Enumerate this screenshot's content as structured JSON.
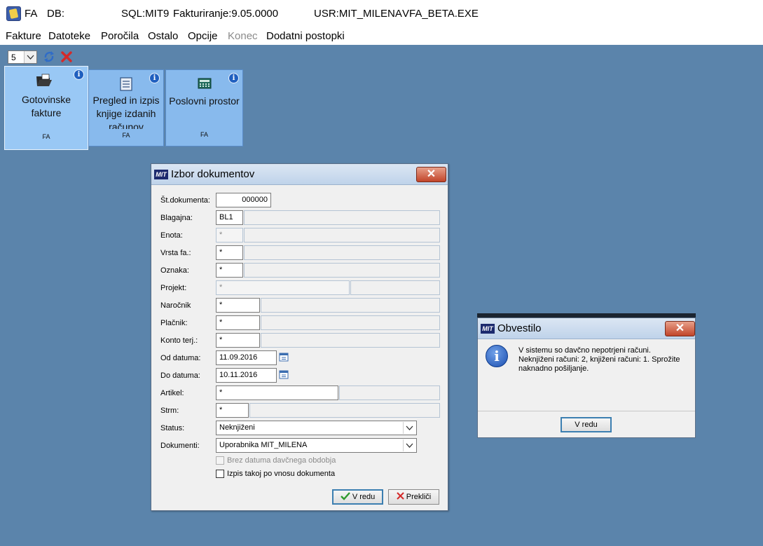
{
  "titlebar": {
    "app": "FA",
    "db": "DB:",
    "sql": "SQL:MIT9",
    "version": "Fakturiranje:9.05.0000",
    "user": "USR:MIT_MILENA",
    "exe": "VFA_BETA.EXE"
  },
  "menu": {
    "fakture": "Fakture",
    "datoteke": "Datoteke",
    "porocila": "Poročila",
    "ostalo": "Ostalo",
    "opcije": "Opcije",
    "konec": "Konec",
    "dodatni": "Dodatni postopki"
  },
  "toolbar": {
    "select_value": "5"
  },
  "tiles": [
    {
      "title": "Gotovinske fakture",
      "code": "FA",
      "info": "i"
    },
    {
      "title": "Pregled in izpis knjige izdanih računov",
      "code": "FA",
      "info": "i"
    },
    {
      "title": "Poslovni prostor",
      "code": "FA",
      "info": "i"
    }
  ],
  "izbor": {
    "logo": "MIT",
    "title": "Izbor dokumentov",
    "close": "✕",
    "fields": {
      "st_dokumenta": {
        "label": "Št.dokumenta:",
        "value": "000000"
      },
      "blagajna": {
        "label": "Blagajna:",
        "value": "BL1"
      },
      "enota": {
        "label": "Enota:",
        "value": "*"
      },
      "vrsta_fa": {
        "label": "Vrsta fa.:",
        "value": "*"
      },
      "oznaka": {
        "label": "Oznaka:",
        "value": "*"
      },
      "projekt": {
        "label": "Projekt:",
        "value": "*"
      },
      "narocnik": {
        "label": "Naročnik",
        "value": "*"
      },
      "placnik": {
        "label": "Plačnik:",
        "value": "*"
      },
      "konto_terj": {
        "label": "Konto terj.:",
        "value": "*"
      },
      "od_datuma": {
        "label": "Od datuma:",
        "value": "11.09.2016"
      },
      "do_datuma": {
        "label": "Do datuma:",
        "value": "10.11.2016"
      },
      "artikel": {
        "label": "Artikel:",
        "value": "*"
      },
      "strm": {
        "label": "Strm:",
        "value": "*"
      },
      "status": {
        "label": "Status:",
        "value": "Neknjiženi"
      },
      "dokumenti": {
        "label": "Dokumenti:",
        "value": "Uporabnika MIT_MILENA"
      }
    },
    "chk_brez": "Brez datuma davčnega obdobja",
    "chk_izpis": "Izpis takoj po vnosu dokumenta",
    "btn_ok": "V redu",
    "btn_cancel": "Prekliči"
  },
  "obvestilo": {
    "logo": "MIT",
    "title": "Obvestilo",
    "close": "✕",
    "message": "V sistemu so davčno nepotrjeni računi. Neknjiženi računi: 2, knjiženi računi: 1. Sprožite naknadno pošiljanje.",
    "icon": "i",
    "btn_ok": "V redu"
  },
  "colors": {
    "desktop": "#5b84ab",
    "tile": "#88baed",
    "tile_active": "#99c8f5",
    "close_red": "#c1452a"
  }
}
